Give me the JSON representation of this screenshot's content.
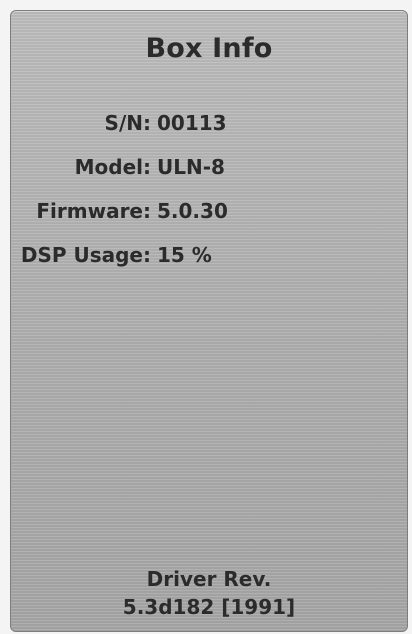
{
  "panel": {
    "title": "Box Info",
    "rows": [
      {
        "label": "S/N:",
        "value": "00113"
      },
      {
        "label": "Model:",
        "value": "ULN-8"
      },
      {
        "label": "Firmware:",
        "value": "5.0.30"
      },
      {
        "label": "DSP Usage:",
        "value": "15 %"
      }
    ],
    "driver": {
      "label": "Driver Rev.",
      "value": "5.3d182 [1991]"
    }
  }
}
